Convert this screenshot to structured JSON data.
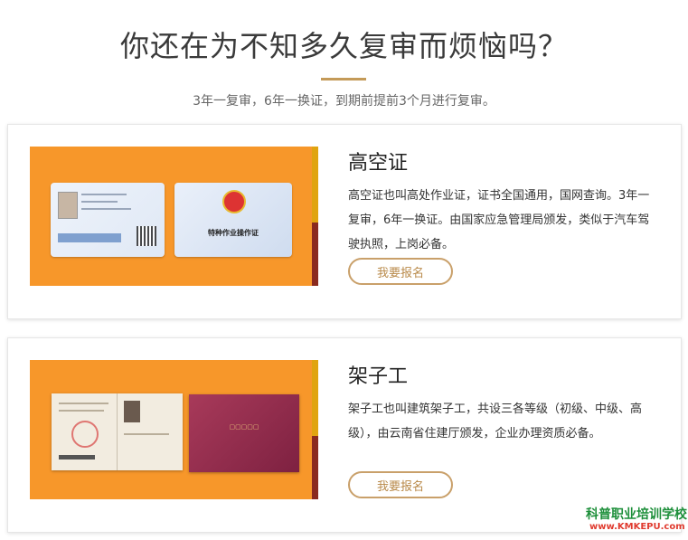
{
  "header": {
    "title": "你还在为不知多久复审而烦恼吗？",
    "subtitle": "3年一复审，6年一换证，到期前提前3个月进行复审。"
  },
  "cards": [
    {
      "title": "高空证",
      "description": "高空证也叫高处作业证，证书全国通用，国网查询。3年一复审，6年一换证。由国家应急管理局颁发，类似于汽车驾驶执照，上岗必备。",
      "button_label": "我要报名",
      "image_text": "特种作业操作证"
    },
    {
      "title": "架子工",
      "description": "架子工也叫建筑架子工，共设三各等级（初级、中级、高级），由云南省住建厅颁发，企业办理资质必备。",
      "button_label": "我要报名"
    }
  ],
  "watermark": {
    "name": "科普职业培训学校",
    "url": "www.KMKEPU.com"
  },
  "colors": {
    "accent": "#c49a58",
    "image_bg": "#f7972a",
    "watermark_green": "#1d8f3a",
    "watermark_red": "#e03a2e"
  }
}
